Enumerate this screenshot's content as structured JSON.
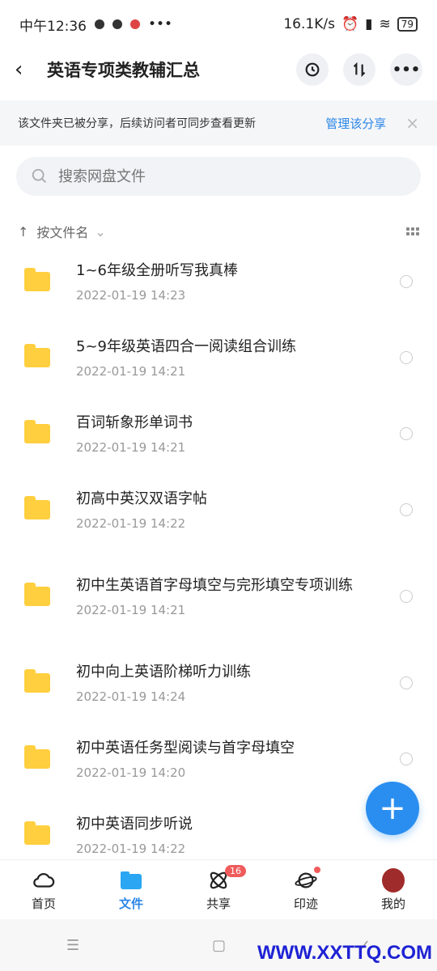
{
  "status": {
    "time": "中午12:36",
    "more": "•••",
    "speed": "16.1K/s",
    "battery": "79"
  },
  "appbar": {
    "title": "英语专项类教辅汇总"
  },
  "banner": {
    "message": "该文件夹已被分享，后续访问者可同步查看更新",
    "link": "管理该分享",
    "close": "×"
  },
  "search": {
    "placeholder": "搜索网盘文件"
  },
  "sort": {
    "arrow": "↑",
    "label": "按文件名",
    "chevron": "⌄"
  },
  "files": [
    {
      "name": "1~6年级全册听写我真棒",
      "date": "2022-01-19  14:23"
    },
    {
      "name": "5~9年级英语四合一阅读组合训练",
      "date": "2022-01-19  14:21"
    },
    {
      "name": "百词斩象形单词书",
      "date": "2022-01-19  14:21"
    },
    {
      "name": "初高中英汉双语字帖",
      "date": "2022-01-19  14:22"
    },
    {
      "name": "初中生英语首字母填空与完形填空专项训练",
      "date": "2022-01-19  14:21"
    },
    {
      "name": "初中向上英语阶梯听力训练",
      "date": "2022-01-19  14:24"
    },
    {
      "name": "初中英语任务型阅读与首字母填空",
      "date": "2022-01-19  14:20"
    },
    {
      "name": "初中英语同步听说",
      "date": "2022-01-19  14:22"
    }
  ],
  "tabs": [
    {
      "label": "首页"
    },
    {
      "label": "文件"
    },
    {
      "label": "共享",
      "badge": "16"
    },
    {
      "label": "印迹"
    },
    {
      "label": "我的"
    }
  ],
  "fab": {
    "label": "+"
  },
  "nav": {
    "menu": "☰",
    "home": "▢",
    "back": "✓"
  },
  "watermark": "WWW.XXTTQ.COM"
}
